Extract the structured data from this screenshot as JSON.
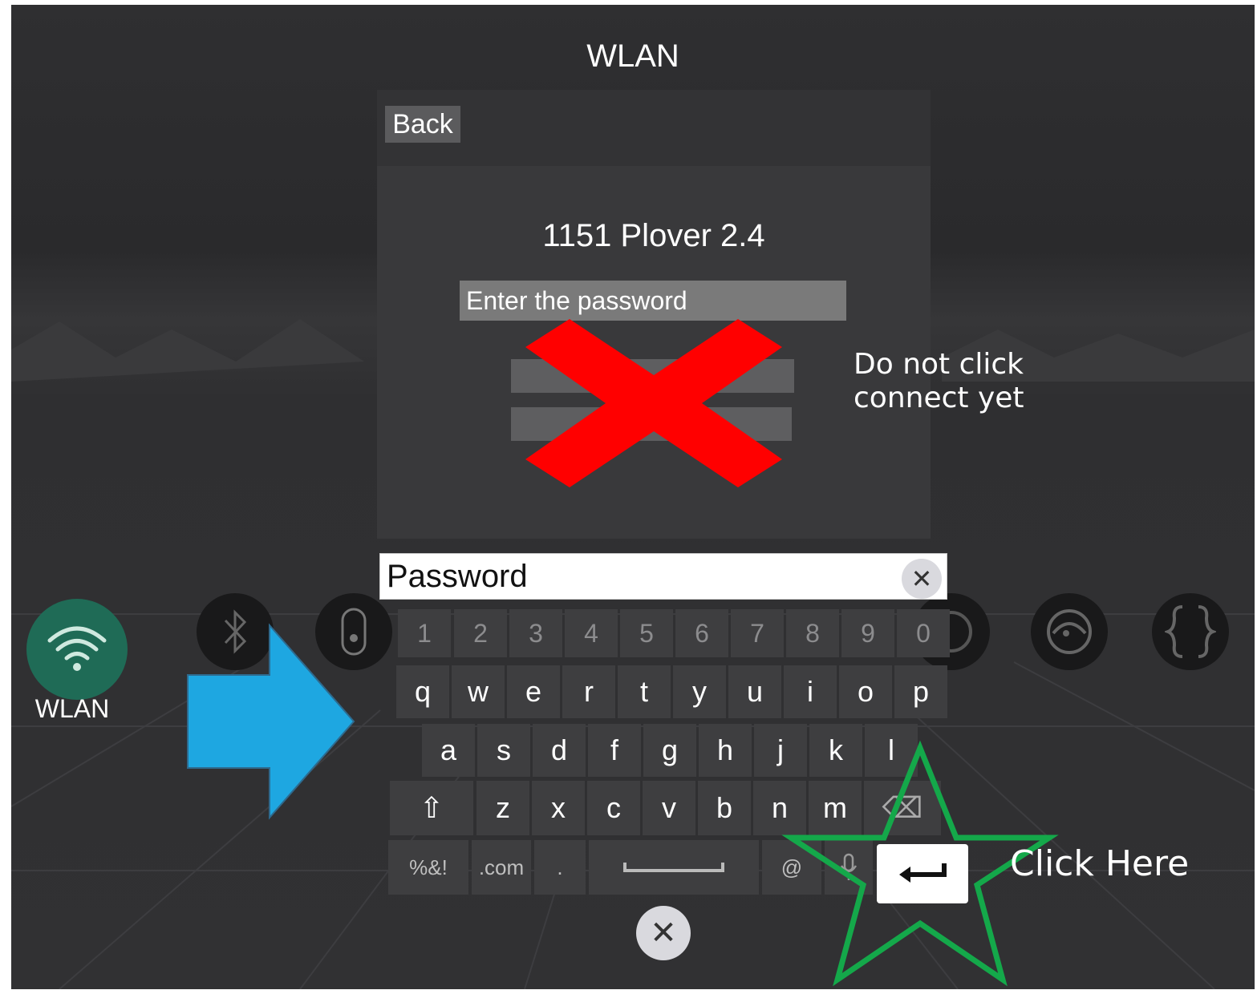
{
  "header": {
    "title": "WLAN"
  },
  "panel": {
    "back_label": "Back",
    "network_name": "1151 Plover 2.4",
    "password_placeholder": "Enter the password"
  },
  "dock": {
    "items": [
      {
        "icon": "wifi-icon",
        "label": "WLAN",
        "selected": true
      },
      {
        "icon": "bluetooth-icon"
      },
      {
        "icon": "controller-icon"
      },
      {
        "icon": "record-icon"
      },
      {
        "icon": "guardian-icon"
      },
      {
        "icon": "developer-braces-icon"
      }
    ]
  },
  "keyboard": {
    "input_placeholder": "Password",
    "rows": [
      [
        "1",
        "2",
        "3",
        "4",
        "5",
        "6",
        "7",
        "8",
        "9",
        "0"
      ],
      [
        "q",
        "w",
        "e",
        "r",
        "t",
        "y",
        "u",
        "i",
        "o",
        "p"
      ],
      [
        "a",
        "s",
        "d",
        "f",
        "g",
        "h",
        "j",
        "k",
        "l"
      ],
      [
        "⇧",
        "z",
        "x",
        "c",
        "v",
        "b",
        "n",
        "m",
        "⌫"
      ],
      [
        "%&!",
        ".com",
        ".",
        "",
        "@",
        "🎤",
        "↵"
      ]
    ],
    "enter_icon": "enter-icon"
  },
  "annotations": {
    "do_not_click": "Do not click\nconnect yet",
    "click_here": "Click Here"
  },
  "colors": {
    "wlan_selected": "#1f6b56",
    "red_x": "#ff0000",
    "arrow": "#1ea7e1",
    "star": "#14a84a"
  }
}
